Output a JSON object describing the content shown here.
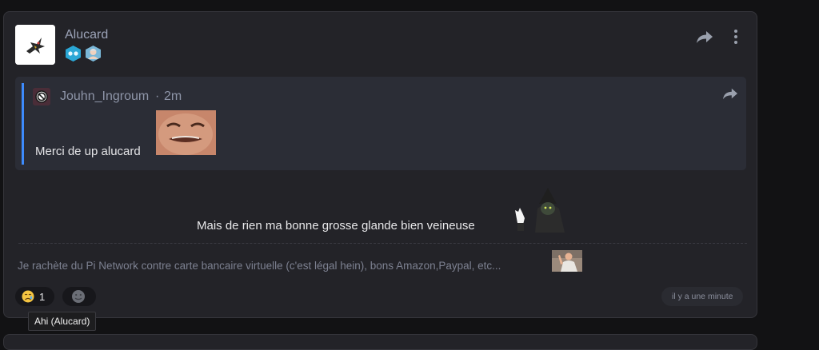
{
  "post": {
    "author": "Alucard",
    "quote": {
      "author": "Jouhn_Ingroum",
      "separator": "·",
      "time": "2m",
      "text": "Merci de up alucard"
    },
    "message": "Mais de rien ma bonne grosse glande bien veineuse",
    "signature": "Je rachète du Pi Network contre carte bancaire virtuelle (c'est légal hein), bons Amazon,Paypal, etc...",
    "reactions": [
      {
        "icon": "sad-face-emoji",
        "count": "1"
      },
      {
        "icon": "add-reaction-emoji"
      }
    ],
    "timestamp": "il y a une minute",
    "tooltip": "Ahi (Alucard)"
  },
  "colors": {
    "background": "#121214",
    "card": "#232328",
    "quote_background": "#2b2d36",
    "quote_accent": "#3d8bfd",
    "username": "#9ca3b8"
  }
}
